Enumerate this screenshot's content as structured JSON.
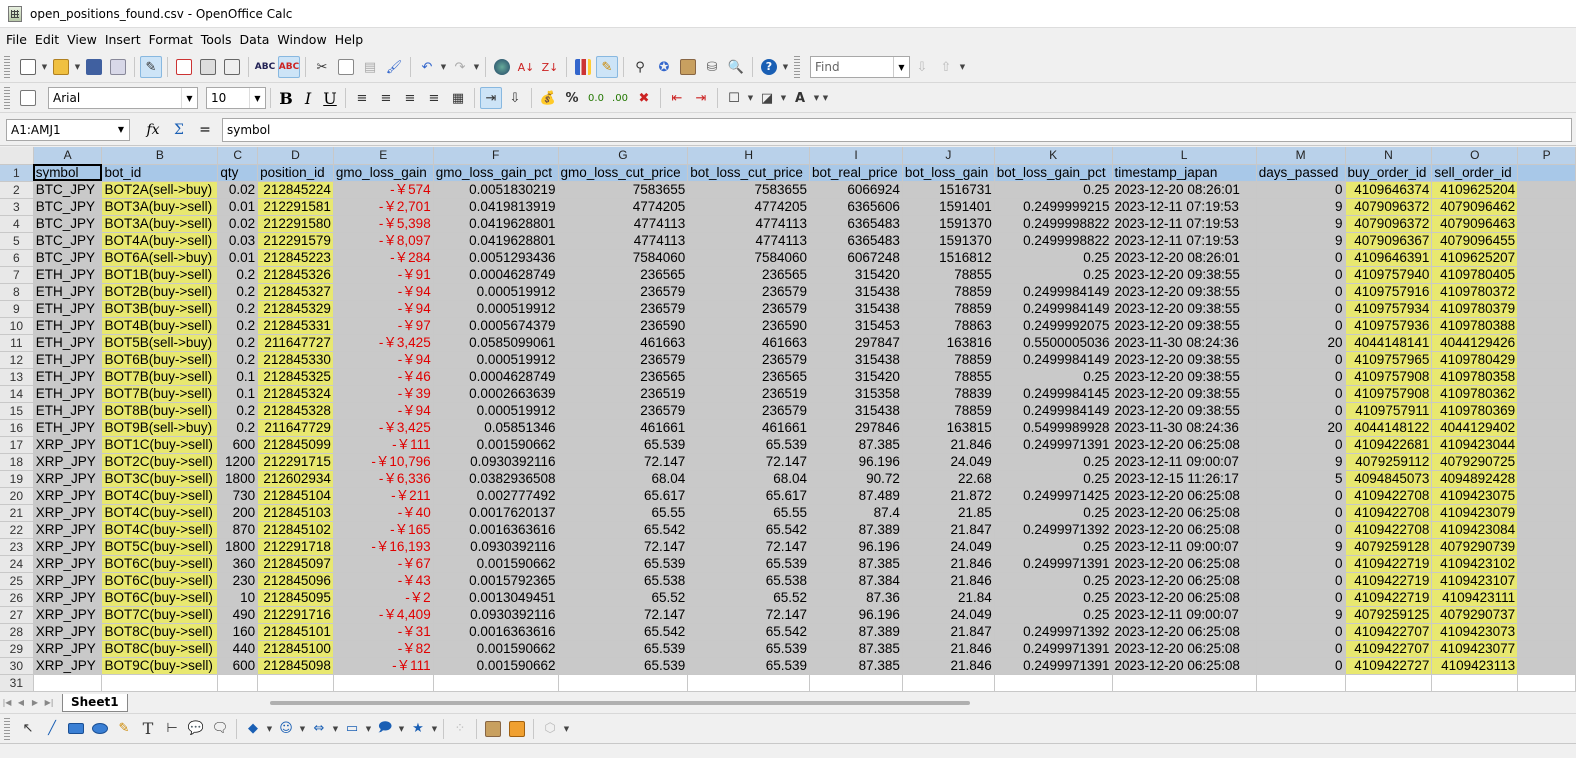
{
  "window": {
    "title": "open_positions_found.csv - OpenOffice Calc"
  },
  "menu": [
    {
      "label": "File"
    },
    {
      "label": "Edit"
    },
    {
      "label": "View"
    },
    {
      "label": "Insert"
    },
    {
      "label": "Format"
    },
    {
      "label": "Tools"
    },
    {
      "label": "Data"
    },
    {
      "label": "Window"
    },
    {
      "label": "Help"
    }
  ],
  "toolbar": {
    "find_placeholder": "Find",
    "font_name": "Arial",
    "font_size": "10",
    "bold": "B",
    "italic": "I",
    "underline": "U",
    "percent": "%"
  },
  "formula_bar": {
    "name_box": "A1:AMJ1",
    "content": "symbol"
  },
  "sheet": {
    "columns": [
      "A",
      "B",
      "C",
      "D",
      "E",
      "F",
      "G",
      "H",
      "I",
      "J",
      "K",
      "L",
      "M",
      "N",
      "O",
      "P"
    ],
    "headers": [
      "symbol",
      "bot_id",
      "qty",
      "position_id",
      "gmo_loss_gain",
      "gmo_loss_gain_pct",
      "gmo_loss_cut_price",
      "bot_loss_cut_price",
      "bot_real_price",
      "bot_loss_gain",
      "bot_loss_gain_pct",
      "timestamp_japan",
      "days_passed",
      "buy_order_id",
      "sell_order_id"
    ],
    "rows": [
      [
        "BTC_JPY",
        "BOT2A(sell->buy)",
        "0.02",
        "212845224",
        "-￥574",
        "0.0051830219",
        "7583655",
        "7583655",
        "6066924",
        "1516731",
        "0.25",
        "2023-12-20 08:26:01",
        "0",
        "4109646374",
        "4109625204"
      ],
      [
        "BTC_JPY",
        "BOT3A(buy->sell)",
        "0.01",
        "212291581",
        "-￥2,701",
        "0.0419813919",
        "4774205",
        "4774205",
        "6365606",
        "1591401",
        "0.2499999215",
        "2023-12-11 07:19:53",
        "9",
        "4079096372",
        "4079096462"
      ],
      [
        "BTC_JPY",
        "BOT3A(buy->sell)",
        "0.02",
        "212291580",
        "-￥5,398",
        "0.0419628801",
        "4774113",
        "4774113",
        "6365483",
        "1591370",
        "0.2499998822",
        "2023-12-11 07:19:53",
        "9",
        "4079096372",
        "4079096463"
      ],
      [
        "BTC_JPY",
        "BOT4A(buy->sell)",
        "0.03",
        "212291579",
        "-￥8,097",
        "0.0419628801",
        "4774113",
        "4774113",
        "6365483",
        "1591370",
        "0.2499998822",
        "2023-12-11 07:19:53",
        "9",
        "4079096367",
        "4079096455"
      ],
      [
        "BTC_JPY",
        "BOT6A(sell->buy)",
        "0.01",
        "212845223",
        "-￥284",
        "0.0051293436",
        "7584060",
        "7584060",
        "6067248",
        "1516812",
        "0.25",
        "2023-12-20 08:26:01",
        "0",
        "4109646391",
        "4109625207"
      ],
      [
        "ETH_JPY",
        "BOT1B(buy->sell)",
        "0.2",
        "212845326",
        "-￥91",
        "0.0004628749",
        "236565",
        "236565",
        "315420",
        "78855",
        "0.25",
        "2023-12-20 09:38:55",
        "0",
        "4109757940",
        "4109780405"
      ],
      [
        "ETH_JPY",
        "BOT2B(buy->sell)",
        "0.2",
        "212845327",
        "-￥94",
        "0.000519912",
        "236579",
        "236579",
        "315438",
        "78859",
        "0.2499984149",
        "2023-12-20 09:38:55",
        "0",
        "4109757916",
        "4109780372"
      ],
      [
        "ETH_JPY",
        "BOT3B(buy->sell)",
        "0.2",
        "212845329",
        "-￥94",
        "0.000519912",
        "236579",
        "236579",
        "315438",
        "78859",
        "0.2499984149",
        "2023-12-20 09:38:55",
        "0",
        "4109757934",
        "4109780379"
      ],
      [
        "ETH_JPY",
        "BOT4B(buy->sell)",
        "0.2",
        "212845331",
        "-￥97",
        "0.0005674379",
        "236590",
        "236590",
        "315453",
        "78863",
        "0.2499992075",
        "2023-12-20 09:38:55",
        "0",
        "4109757936",
        "4109780388"
      ],
      [
        "ETH_JPY",
        "BOT5B(sell->buy)",
        "0.2",
        "211647727",
        "-￥3,425",
        "0.0585099061",
        "461663",
        "461663",
        "297847",
        "163816",
        "0.5500005036",
        "2023-11-30 08:24:36",
        "20",
        "4044148141",
        "4044129426"
      ],
      [
        "ETH_JPY",
        "BOT6B(buy->sell)",
        "0.2",
        "212845330",
        "-￥94",
        "0.000519912",
        "236579",
        "236579",
        "315438",
        "78859",
        "0.2499984149",
        "2023-12-20 09:38:55",
        "0",
        "4109757965",
        "4109780429"
      ],
      [
        "ETH_JPY",
        "BOT7B(buy->sell)",
        "0.1",
        "212845325",
        "-￥46",
        "0.0004628749",
        "236565",
        "236565",
        "315420",
        "78855",
        "0.25",
        "2023-12-20 09:38:55",
        "0",
        "4109757908",
        "4109780358"
      ],
      [
        "ETH_JPY",
        "BOT7B(buy->sell)",
        "0.1",
        "212845324",
        "-￥39",
        "0.0002663639",
        "236519",
        "236519",
        "315358",
        "78839",
        "0.2499984145",
        "2023-12-20 09:38:55",
        "0",
        "4109757908",
        "4109780362"
      ],
      [
        "ETH_JPY",
        "BOT8B(buy->sell)",
        "0.2",
        "212845328",
        "-￥94",
        "0.000519912",
        "236579",
        "236579",
        "315438",
        "78859",
        "0.2499984149",
        "2023-12-20 09:38:55",
        "0",
        "4109757911",
        "4109780369"
      ],
      [
        "ETH_JPY",
        "BOT9B(sell->buy)",
        "0.2",
        "211647729",
        "-￥3,425",
        "0.05851346",
        "461661",
        "461661",
        "297846",
        "163815",
        "0.5499989928",
        "2023-11-30 08:24:36",
        "20",
        "4044148122",
        "4044129402"
      ],
      [
        "XRP_JPY",
        "BOT1C(buy->sell)",
        "600",
        "212845099",
        "-￥111",
        "0.001590662",
        "65.539",
        "65.539",
        "87.385",
        "21.846",
        "0.2499971391",
        "2023-12-20 06:25:08",
        "0",
        "4109422681",
        "4109423044"
      ],
      [
        "XRP_JPY",
        "BOT2C(buy->sell)",
        "1200",
        "212291715",
        "-￥10,796",
        "0.0930392116",
        "72.147",
        "72.147",
        "96.196",
        "24.049",
        "0.25",
        "2023-12-11 09:00:07",
        "9",
        "4079259112",
        "4079290725"
      ],
      [
        "XRP_JPY",
        "BOT3C(buy->sell)",
        "1800",
        "212602934",
        "-￥6,336",
        "0.0382936508",
        "68.04",
        "68.04",
        "90.72",
        "22.68",
        "0.25",
        "2023-12-15 11:26:17",
        "5",
        "4094845073",
        "4094892428"
      ],
      [
        "XRP_JPY",
        "BOT4C(buy->sell)",
        "730",
        "212845104",
        "-￥211",
        "0.002777492",
        "65.617",
        "65.617",
        "87.489",
        "21.872",
        "0.2499971425",
        "2023-12-20 06:25:08",
        "0",
        "4109422708",
        "4109423075"
      ],
      [
        "XRP_JPY",
        "BOT4C(buy->sell)",
        "200",
        "212845103",
        "-￥40",
        "0.0017620137",
        "65.55",
        "65.55",
        "87.4",
        "21.85",
        "0.25",
        "2023-12-20 06:25:08",
        "0",
        "4109422708",
        "4109423079"
      ],
      [
        "XRP_JPY",
        "BOT4C(buy->sell)",
        "870",
        "212845102",
        "-￥165",
        "0.0016363616",
        "65.542",
        "65.542",
        "87.389",
        "21.847",
        "0.2499971392",
        "2023-12-20 06:25:08",
        "0",
        "4109422708",
        "4109423084"
      ],
      [
        "XRP_JPY",
        "BOT5C(buy->sell)",
        "1800",
        "212291718",
        "-￥16,193",
        "0.0930392116",
        "72.147",
        "72.147",
        "96.196",
        "24.049",
        "0.25",
        "2023-12-11 09:00:07",
        "9",
        "4079259128",
        "4079290739"
      ],
      [
        "XRP_JPY",
        "BOT6C(buy->sell)",
        "360",
        "212845097",
        "-￥67",
        "0.001590662",
        "65.539",
        "65.539",
        "87.385",
        "21.846",
        "0.2499971391",
        "2023-12-20 06:25:08",
        "0",
        "4109422719",
        "4109423102"
      ],
      [
        "XRP_JPY",
        "BOT6C(buy->sell)",
        "230",
        "212845096",
        "-￥43",
        "0.0015792365",
        "65.538",
        "65.538",
        "87.384",
        "21.846",
        "0.25",
        "2023-12-20 06:25:08",
        "0",
        "4109422719",
        "4109423107"
      ],
      [
        "XRP_JPY",
        "BOT6C(buy->sell)",
        "10",
        "212845095",
        "-￥2",
        "0.0013049451",
        "65.52",
        "65.52",
        "87.36",
        "21.84",
        "0.25",
        "2023-12-20 06:25:08",
        "0",
        "4109422719",
        "4109423111"
      ],
      [
        "XRP_JPY",
        "BOT7C(buy->sell)",
        "490",
        "212291716",
        "-￥4,409",
        "0.0930392116",
        "72.147",
        "72.147",
        "96.196",
        "24.049",
        "0.25",
        "2023-12-11 09:00:07",
        "9",
        "4079259125",
        "4079290737"
      ],
      [
        "XRP_JPY",
        "BOT8C(buy->sell)",
        "160",
        "212845101",
        "-￥31",
        "0.0016363616",
        "65.542",
        "65.542",
        "87.389",
        "21.847",
        "0.2499971392",
        "2023-12-20 06:25:08",
        "0",
        "4109422707",
        "4109423073"
      ],
      [
        "XRP_JPY",
        "BOT8C(buy->sell)",
        "440",
        "212845100",
        "-￥82",
        "0.001590662",
        "65.539",
        "65.539",
        "87.385",
        "21.846",
        "0.2499971391",
        "2023-12-20 06:25:08",
        "0",
        "4109422707",
        "4109423077"
      ],
      [
        "XRP_JPY",
        "BOT9C(buy->sell)",
        "600",
        "212845098",
        "-￥111",
        "0.001590662",
        "65.539",
        "65.539",
        "87.385",
        "21.846",
        "0.2499971391",
        "2023-12-20 06:25:08",
        "0",
        "4109422727",
        "4109423113"
      ]
    ]
  },
  "tabs": [
    {
      "label": "Sheet1"
    }
  ],
  "colors": {
    "selection_header": "#b9d1ea",
    "highlight_yellow": "#e8e870",
    "negative_red": "#e00000",
    "cell_gray": "#c9c9c9"
  }
}
